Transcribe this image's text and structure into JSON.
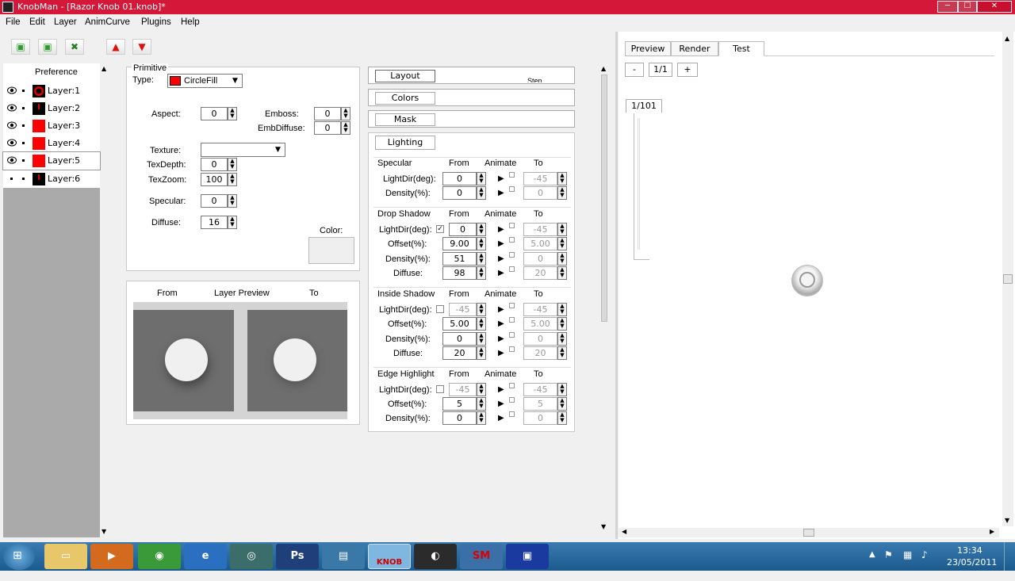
{
  "window": {
    "title": "KnobMan - [Razor Knob 01.knob]*",
    "min": "─",
    "max": "☐",
    "close": "✕"
  },
  "menu": [
    "File",
    "Edit",
    "Layer",
    "AnimCurve",
    "Plugins",
    "Help"
  ],
  "layers": {
    "header": "Preference",
    "items": [
      {
        "label": "Layer:1",
        "color": "#e00000"
      },
      {
        "label": "Layer:2",
        "color": "#8a0000"
      },
      {
        "label": "Layer:3",
        "color": "#ff0000"
      },
      {
        "label": "Layer:4",
        "color": "#ff0000"
      },
      {
        "label": "Layer:5",
        "color": "#ff0000"
      },
      {
        "label": "Layer:6",
        "color": "#8a0000"
      }
    ]
  },
  "primitive": {
    "group": "Primitive",
    "type_label": "Type:",
    "type_value": "CircleFill",
    "aspect_label": "Aspect:",
    "aspect": "0",
    "emboss_label": "Emboss:",
    "emboss": "0",
    "embdiffuse_label": "EmbDiffuse:",
    "embdiffuse": "0",
    "texture_label": "Texture:",
    "texdepth_label": "TexDepth:",
    "texdepth": "0",
    "texzoom_label": "TexZoom:",
    "texzoom": "100",
    "specular_label": "Specular:",
    "specular": "0",
    "diffuse_label": "Diffuse:",
    "diffuse": "16",
    "color_label": "Color:"
  },
  "preview": {
    "from": "From",
    "title": "Layer Preview",
    "to": "To"
  },
  "effects": {
    "layout": "Layout",
    "colors": "Colors",
    "mask": "Mask",
    "lighting": "Lighting",
    "step_label": "Step",
    "col_from": "From",
    "col_animate": "Animate",
    "col_to": "To",
    "specular": {
      "title": "Specular",
      "rows": [
        {
          "label": "LightDir(deg):",
          "from": "0",
          "to": "-45"
        },
        {
          "label": "Density(%):",
          "from": "0",
          "to": "0"
        }
      ]
    },
    "drop_shadow": {
      "title": "Drop Shadow",
      "rows": [
        {
          "label": "LightDir(deg):",
          "from": "0",
          "to": "-45"
        },
        {
          "label": "Offset(%):",
          "from": "9.00",
          "to": "5.00"
        },
        {
          "label": "Density(%):",
          "from": "51",
          "to": "0"
        },
        {
          "label": "Diffuse:",
          "from": "98",
          "to": "20"
        }
      ]
    },
    "inside_shadow": {
      "title": "Inside Shadow",
      "rows": [
        {
          "label": "LightDir(deg):",
          "from": "-45",
          "to": "-45"
        },
        {
          "label": "Offset(%):",
          "from": "5.00",
          "to": "5.00"
        },
        {
          "label": "Density(%):",
          "from": "0",
          "to": "0"
        },
        {
          "label": "Diffuse:",
          "from": "20",
          "to": "20"
        }
      ]
    },
    "edge_highlight": {
      "title": "Edge Highlight",
      "rows": [
        {
          "label": "LightDir(deg):",
          "from": "-45",
          "to": "-45"
        },
        {
          "label": "Offset(%):",
          "from": "5",
          "to": "5"
        },
        {
          "label": "Density(%):",
          "from": "0",
          "to": "0"
        }
      ]
    }
  },
  "right": {
    "tabs": [
      "Preview",
      "Render",
      "Test"
    ],
    "minus": "-",
    "frame": "1/1",
    "plus": "+",
    "counter": "1/101"
  },
  "taskbar": {
    "ps": "Ps",
    "knob": "KNOB",
    "sm": "SM",
    "time": "13:34",
    "date": "23/05/2011"
  }
}
